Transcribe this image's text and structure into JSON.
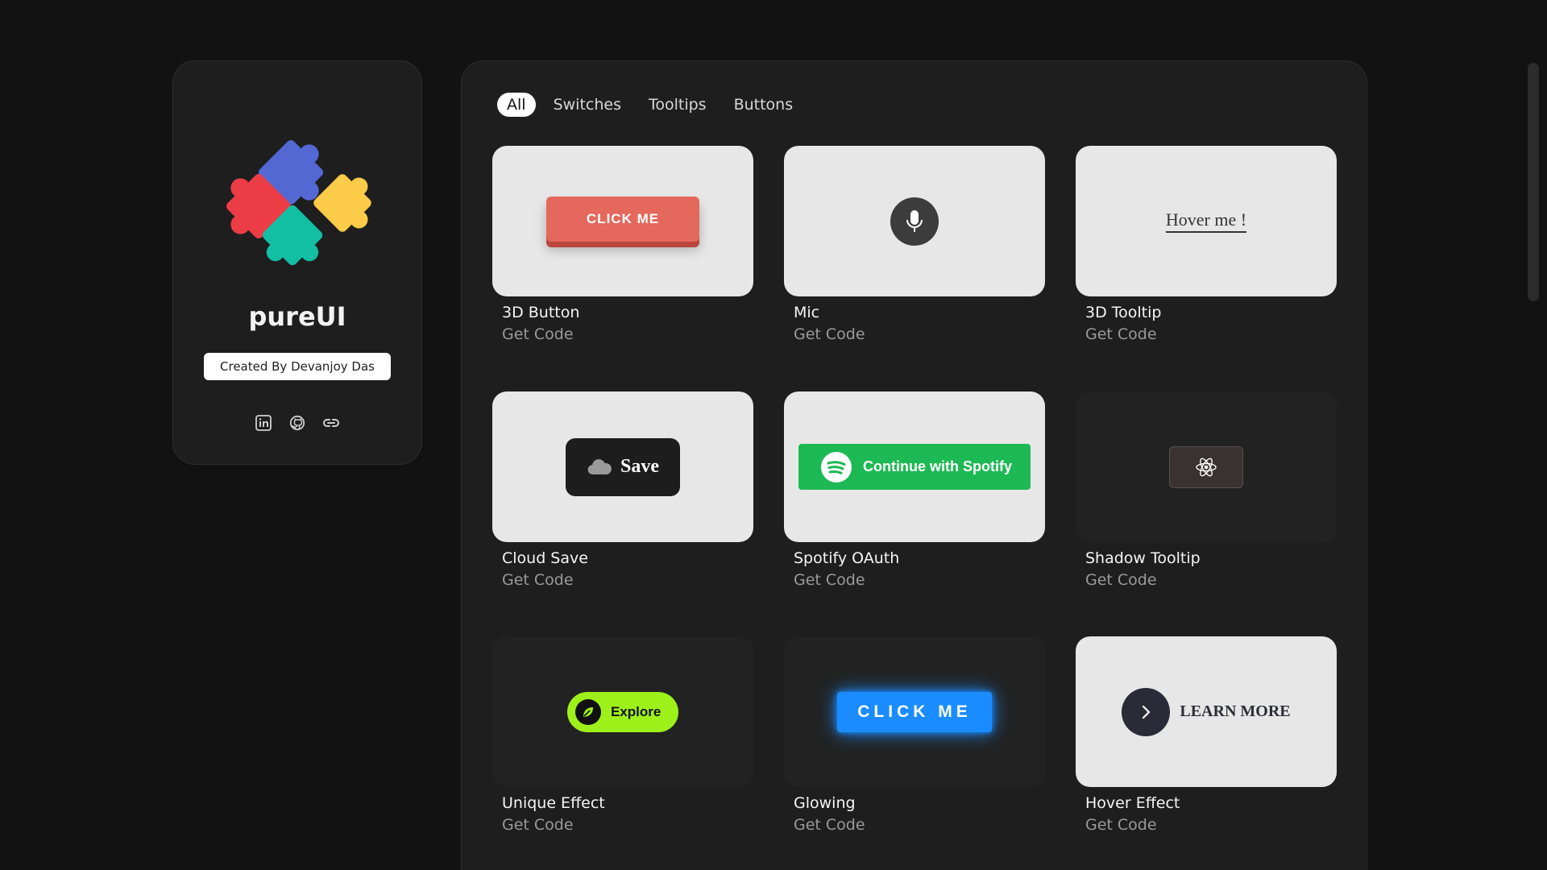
{
  "brand": {
    "name": "pureUI",
    "credit": "Created By Devanjoy Das",
    "logo_icon": "puzzle-pieces-icon",
    "socials": [
      "linkedin-icon",
      "github-icon",
      "link-icon"
    ]
  },
  "tabs": [
    {
      "label": "All",
      "active": true
    },
    {
      "label": "Switches",
      "active": false
    },
    {
      "label": "Tooltips",
      "active": false
    },
    {
      "label": "Buttons",
      "active": false
    }
  ],
  "cards": [
    {
      "title": "3D Button",
      "link": "Get Code",
      "preview_text": "CLICK ME"
    },
    {
      "title": "Mic",
      "link": "Get Code",
      "preview_icon": "microphone-icon"
    },
    {
      "title": "3D Tooltip",
      "link": "Get Code",
      "preview_text": "Hover me !"
    },
    {
      "title": "Cloud Save",
      "link": "Get Code",
      "preview_text": "Save",
      "preview_icon": "cloud-icon"
    },
    {
      "title": "Spotify OAuth",
      "link": "Get Code",
      "preview_text": "Continue with Spotify",
      "preview_icon": "spotify-icon"
    },
    {
      "title": "Shadow Tooltip",
      "link": "Get Code",
      "preview_icon": "react-atom-icon"
    },
    {
      "title": "Unique Effect",
      "link": "Get Code",
      "preview_text": "Explore",
      "preview_icon": "leaf-icon"
    },
    {
      "title": "Glowing",
      "link": "Get Code",
      "preview_text": "CLICK ME"
    },
    {
      "title": "Hover Effect",
      "link": "Get Code",
      "preview_text": "LEARN MORE",
      "preview_icon": "chevron-right-icon"
    }
  ],
  "colors": {
    "background": "#121212",
    "panel": "#1e1e1e",
    "btn3d": "#e4685c",
    "spotify": "#1db954",
    "explore": "#9ef01a",
    "glow": "#1a8cff"
  }
}
